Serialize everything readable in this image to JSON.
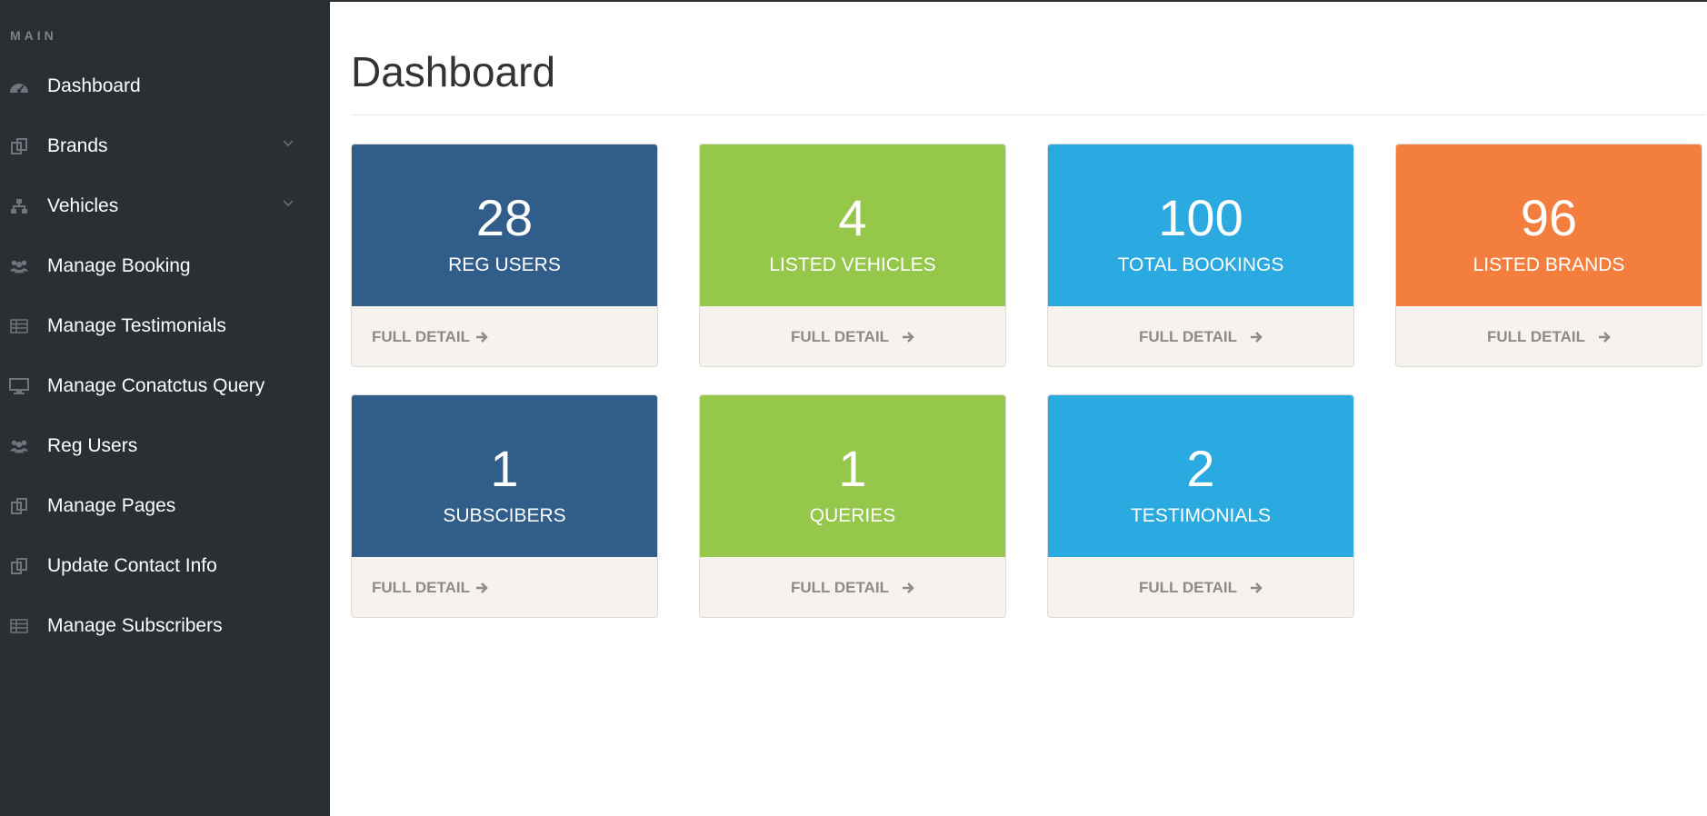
{
  "sidebar": {
    "section_label": "MAIN",
    "items": [
      {
        "label": "Dashboard",
        "icon": "dashboard-icon",
        "has_children": false
      },
      {
        "label": "Brands",
        "icon": "copy-icon",
        "has_children": true
      },
      {
        "label": "Vehicles",
        "icon": "sitemap-icon",
        "has_children": true
      },
      {
        "label": "Manage Booking",
        "icon": "users-icon",
        "has_children": false
      },
      {
        "label": "Manage Testimonials",
        "icon": "table-icon",
        "has_children": false
      },
      {
        "label": "Manage Conatctus Query",
        "icon": "desktop-icon",
        "has_children": false
      },
      {
        "label": "Reg Users",
        "icon": "users-icon",
        "has_children": false
      },
      {
        "label": "Manage Pages",
        "icon": "copy-icon",
        "has_children": false
      },
      {
        "label": "Update Contact Info",
        "icon": "copy-icon",
        "has_children": false
      },
      {
        "label": "Manage Subscribers",
        "icon": "table-icon",
        "has_children": false
      }
    ]
  },
  "main": {
    "title": "Dashboard",
    "cards": [
      {
        "value": "28",
        "label": "REG USERS",
        "link": "FULL DETAIL",
        "color": "#315d8b"
      },
      {
        "value": "4",
        "label": "LISTED VEHICLES",
        "link": "FULL DETAIL",
        "color": "#95c74a"
      },
      {
        "value": "100",
        "label": "TOTAL BOOKINGS",
        "link": "FULL DETAIL",
        "color": "#2aaae0"
      },
      {
        "value": "96",
        "label": "LISTED BRANDS",
        "link": "FULL DETAIL",
        "color": "#f47e3d"
      },
      {
        "value": "1",
        "label": "SUBSCIBERS",
        "link": "FULL DETAIL",
        "color": "#315d8b"
      },
      {
        "value": "1",
        "label": "QUERIES",
        "link": "FULL DETAIL",
        "color": "#95c74a"
      },
      {
        "value": "2",
        "label": "TESTIMONIALS",
        "link": "FULL DETAIL",
        "color": "#2aaae0"
      }
    ]
  },
  "colors": {
    "sidebar_bg": "#2a2f34",
    "sidebar_icon": "#6f757c",
    "card_footer_bg": "#f6f3ee",
    "card_footer_text": "#8f8b84"
  }
}
